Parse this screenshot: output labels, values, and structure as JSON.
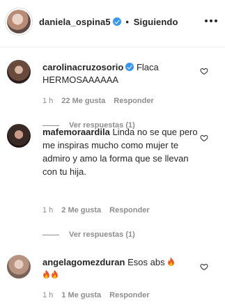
{
  "header": {
    "username": "daniela_ospina5",
    "separator": "•",
    "follow_status": "Siguiendo"
  },
  "comments": [
    {
      "username": "carolinacruzosorio",
      "verified": true,
      "text": "Flaca HERMOSAAAAAA",
      "time": "1 h",
      "likes": "22 Me gusta",
      "reply": "Responder",
      "view_replies": "Ver respuestas (1)"
    },
    {
      "username": "mafemoraardila",
      "verified": false,
      "text": "Linda no se que pero me inspiras mucho como mujer te admiro y amo la forma que se llevan con tu hija.",
      "time": "1 h",
      "likes": "2 Me gusta",
      "reply": "Responder",
      "view_replies": "Ver respuestas (1)"
    },
    {
      "username": "angelagomezduran",
      "verified": false,
      "text": "Esos abs",
      "time": "1 h",
      "likes": "1 Me gusta",
      "reply": "Responder"
    }
  ],
  "colors": {
    "verified": "#3897f0",
    "muted": "#8e8e8e",
    "text": "#262626"
  }
}
